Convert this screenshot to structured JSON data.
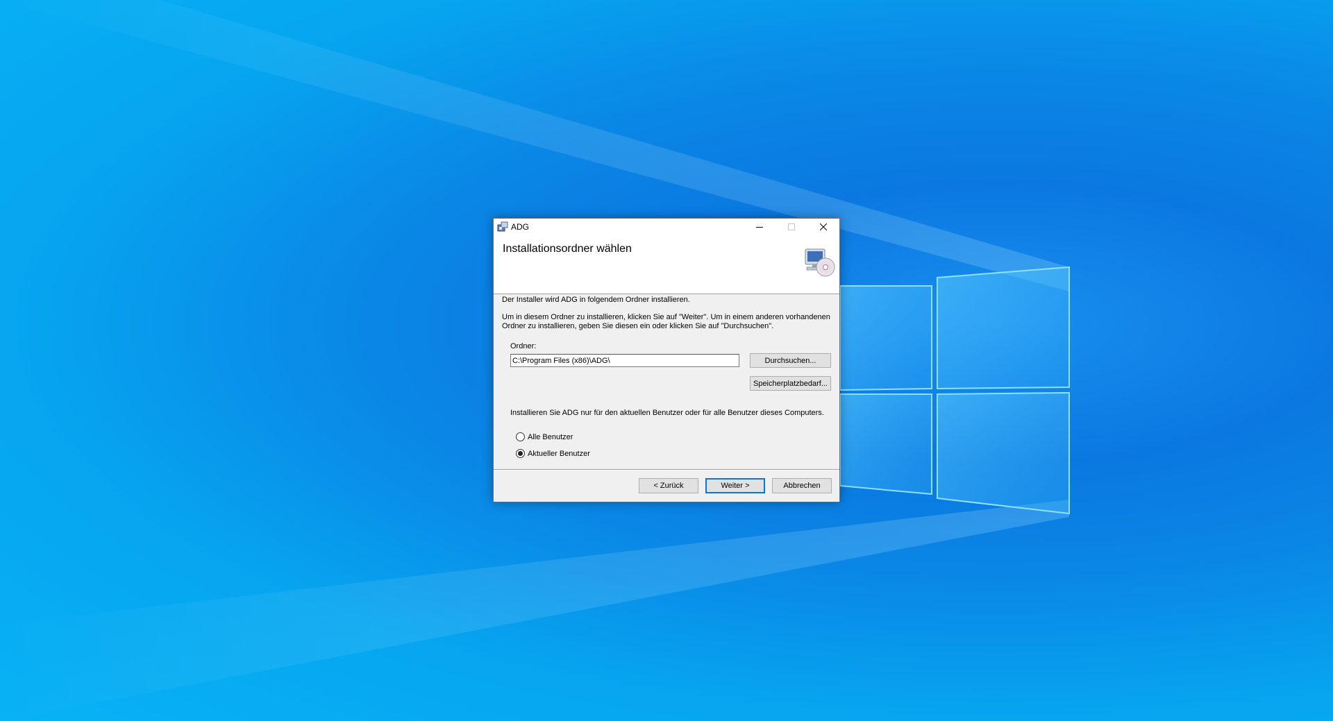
{
  "window": {
    "title": "ADG",
    "app_icon": "installer-icon",
    "controls": {
      "minimize": "minimize-icon",
      "maximize": "maximize-icon",
      "close": "close-icon"
    }
  },
  "header": {
    "title": "Installationsordner wählen",
    "icon": "computer-cd-icon"
  },
  "body": {
    "intro": "Der Installer wird ADG in folgendem Ordner installieren.",
    "instructions": "Um in diesem Ordner zu installieren, klicken Sie auf \"Weiter\". Um in einem anderen vorhandenen Ordner zu installieren, geben Sie diesen ein oder klicken Sie auf \"Durchsuchen\".",
    "folder_label": "Ordner:",
    "folder_value": "C:\\Program Files (x86)\\ADG\\",
    "browse_button": "Durchsuchen...",
    "disk_cost_button": "Speicherplatzbedarf...",
    "scope_text": "Installieren Sie ADG nur für den aktuellen Benutzer oder für alle Benutzer dieses Computers.",
    "radio_options": [
      {
        "label": "Alle Benutzer",
        "selected": false
      },
      {
        "label": "Aktueller Benutzer",
        "selected": true
      }
    ]
  },
  "footer": {
    "back_button": "< Zurück",
    "next_button": "Weiter >",
    "cancel_button": "Abbrechen"
  },
  "colors": {
    "desktop_accent": "#0a78e0",
    "focus_border": "#0078d7",
    "dialog_bg": "#f0f0f0"
  }
}
